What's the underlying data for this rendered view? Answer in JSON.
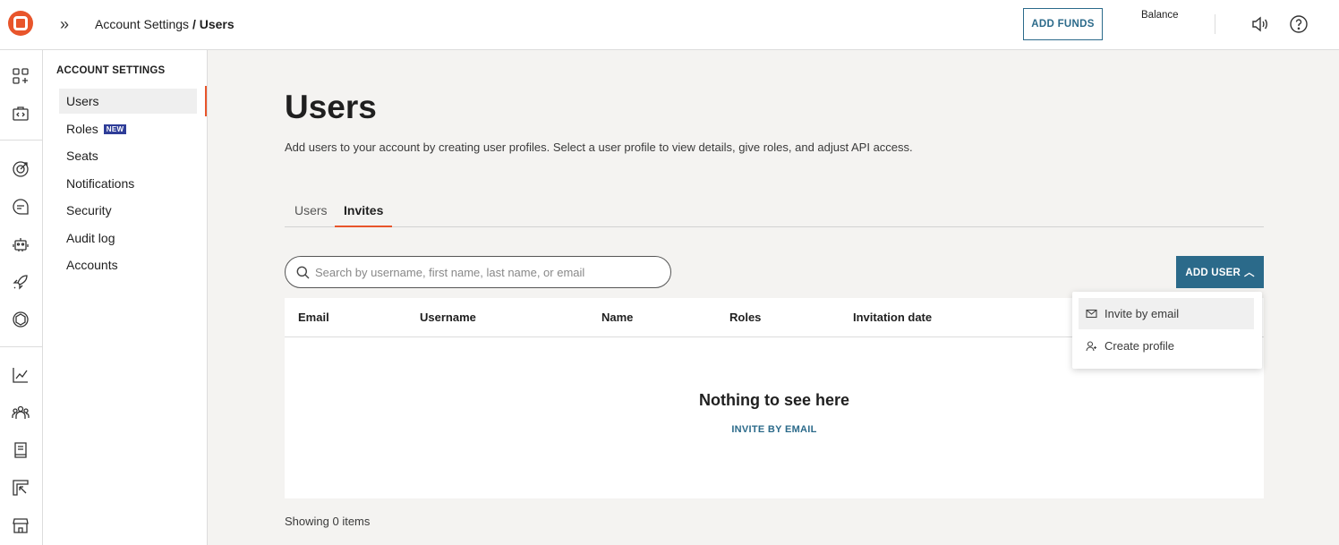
{
  "header": {
    "breadcrumb_parent": "Account Settings",
    "breadcrumb_separator": " / ",
    "breadcrumb_current": "Users",
    "add_funds_label": "ADD FUNDS",
    "balance_label": "Balance"
  },
  "rail": {
    "icons": [
      "apps-add-icon",
      "code-box-icon",
      "target-icon",
      "chat-icon",
      "robot-icon",
      "rocket-icon",
      "openai-icon",
      "chart-line-icon",
      "team-icon",
      "book-icon",
      "report-icon",
      "store-icon"
    ]
  },
  "settings_nav": {
    "title": "ACCOUNT SETTINGS",
    "items": [
      {
        "label": "Users",
        "active": true
      },
      {
        "label": "Roles",
        "badge": "NEW"
      },
      {
        "label": "Seats"
      },
      {
        "label": "Notifications"
      },
      {
        "label": "Security"
      },
      {
        "label": "Audit log"
      },
      {
        "label": "Accounts"
      }
    ]
  },
  "main": {
    "title": "Users",
    "description": "Add users to your account by creating user profiles. Select a user profile to view details, give roles, and adjust API access.",
    "tabs": [
      {
        "label": "Users"
      },
      {
        "label": "Invites",
        "active": true
      }
    ],
    "search": {
      "placeholder": "Search by username, first name, last name, or email",
      "value": ""
    },
    "add_user_label": "ADD USER",
    "table": {
      "columns": [
        "Email",
        "Username",
        "Name",
        "Roles",
        "Invitation date"
      ],
      "rows": [],
      "empty_title": "Nothing to see here",
      "empty_link": "INVITE BY EMAIL"
    },
    "showing": "Showing 0 items"
  },
  "dropdown": {
    "items": [
      {
        "label": "Invite by email",
        "icon": "mail-icon"
      },
      {
        "label": "Create profile",
        "icon": "user-add-icon"
      }
    ]
  },
  "colors": {
    "accent": "#e8552b",
    "primary": "#2b6a8a",
    "badge": "#2e3d98",
    "background": "#f4f3f1"
  }
}
